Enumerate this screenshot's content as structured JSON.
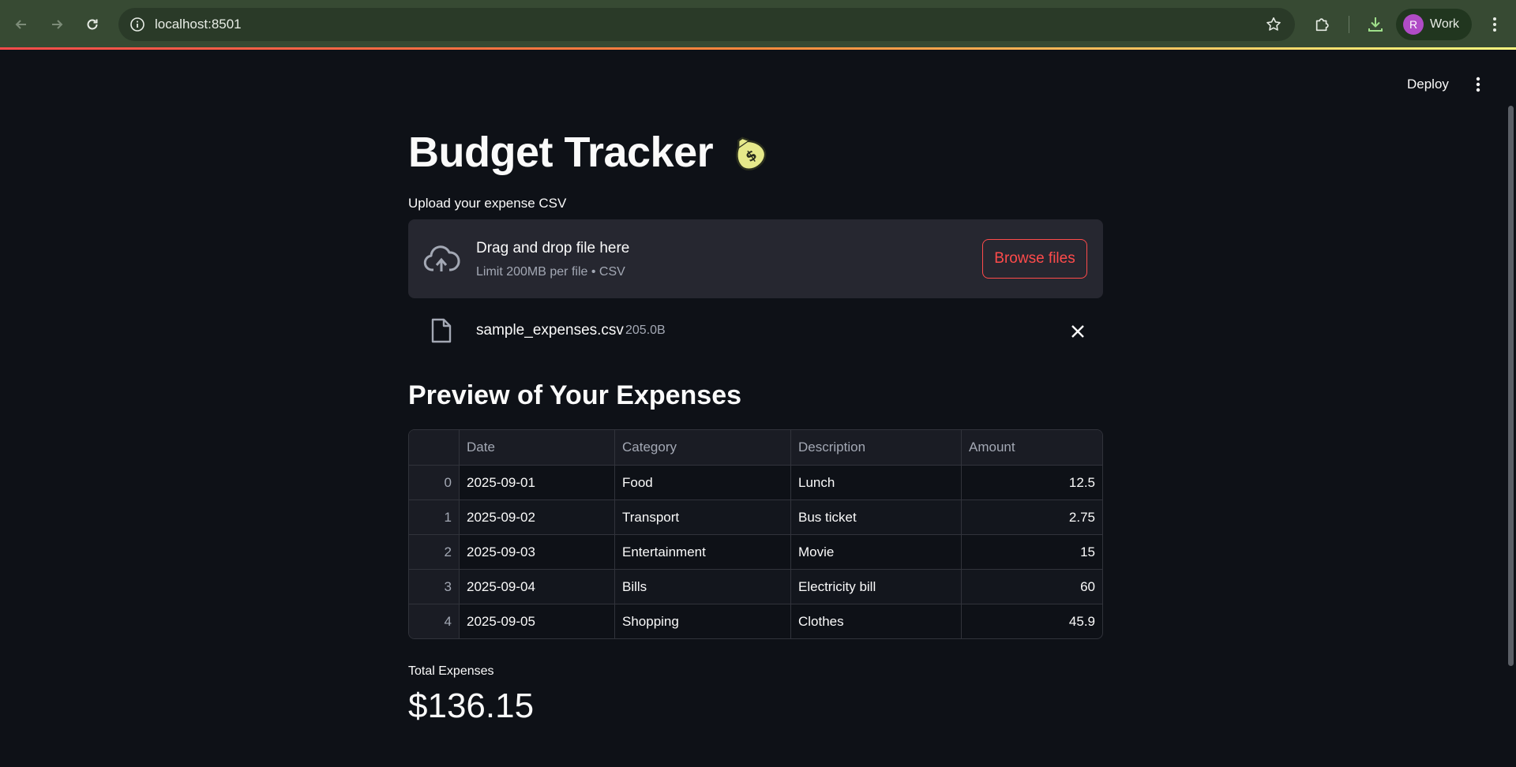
{
  "browser": {
    "url": "localhost:8501",
    "profile_initial": "R",
    "profile_name": "Work"
  },
  "header": {
    "deploy_label": "Deploy"
  },
  "page": {
    "title": "Budget Tracker",
    "title_emoji": "money-bag-emoji",
    "uploader": {
      "label": "Upload your expense CSV",
      "drop_text": "Drag and drop file here",
      "limit_text": "Limit 200MB per file • CSV",
      "browse_label": "Browse files"
    },
    "file": {
      "name": "sample_expenses.csv",
      "size": "205.0B"
    },
    "preview_heading": "Preview of Your Expenses",
    "table": {
      "columns": [
        "",
        "Date",
        "Category",
        "Description",
        "Amount"
      ],
      "rows": [
        [
          "0",
          "2025-09-01",
          "Food",
          "Lunch",
          "12.5"
        ],
        [
          "1",
          "2025-09-02",
          "Transport",
          "Bus ticket",
          "2.75"
        ],
        [
          "2",
          "2025-09-03",
          "Entertainment",
          "Movie",
          "15"
        ],
        [
          "3",
          "2025-09-04",
          "Bills",
          "Electricity bill",
          "60"
        ],
        [
          "4",
          "2025-09-05",
          "Shopping",
          "Clothes",
          "45.9"
        ]
      ]
    },
    "metric": {
      "label": "Total Expenses",
      "value": "$136.15"
    }
  },
  "colors": {
    "background": "#0e1117",
    "accent": "#ff4b4b",
    "chrome": "#374a33",
    "dropzone": "#262730"
  }
}
